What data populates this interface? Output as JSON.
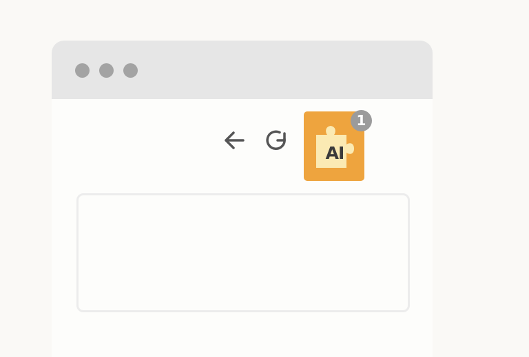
{
  "window": {
    "title_dots": [
      "close",
      "minimize",
      "maximize"
    ]
  },
  "toolbar": {
    "back_icon": "arrow-left-icon",
    "reload_icon": "reload-icon",
    "extension": {
      "label": "AI",
      "icon": "puzzle-piece-icon",
      "badge_count": "1",
      "color": "#eea43e"
    }
  },
  "main": {
    "content_box_text": ""
  }
}
